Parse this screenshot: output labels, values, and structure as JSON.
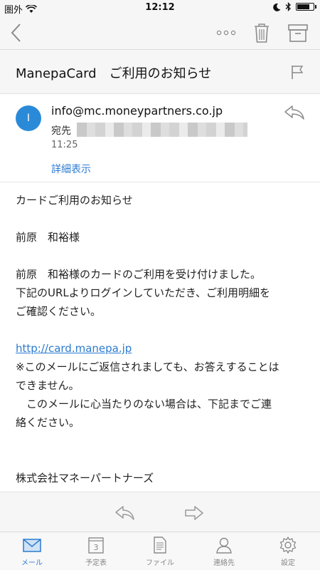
{
  "status_bar": {
    "carrier": "圏外",
    "time": "12:12",
    "battery_level": 0.85
  },
  "subject": "ManepaCard　ご利用のお知らせ",
  "sender": {
    "avatar_initial": "I",
    "email": "info@mc.moneypartners.co.jp",
    "recipient_label": "宛先",
    "time": "11:25",
    "details_link": "詳細表示"
  },
  "body": {
    "line1": "カードご利用のお知らせ",
    "line2": "前原　和裕様",
    "line3": "前原　和裕様のカードのご利用を受け付けました。",
    "line4": "下記のURLよりログインしていただき、ご利用明細を",
    "line5": "ご確認ください。",
    "link": "http://card.manepa.jp",
    "line6": "※このメールにご返信されましても、お答えすることは",
    "line7": "できません。",
    "line8": "　このメールに心当たりのない場合は、下記までご連",
    "line9": "絡ください。",
    "line10": "株式会社マネーパートナーズ"
  },
  "tabs": [
    {
      "label": "メール",
      "icon": "mail-icon"
    },
    {
      "label": "予定表",
      "icon": "calendar-icon",
      "day": "3"
    },
    {
      "label": "ファイル",
      "icon": "file-icon"
    },
    {
      "label": "連絡先",
      "icon": "contact-icon"
    },
    {
      "label": "設定",
      "icon": "gear-icon"
    }
  ],
  "colors": {
    "accent": "#2b7bd0",
    "avatar": "#2b8ad8",
    "bar_bg": "#f6f6f6"
  }
}
